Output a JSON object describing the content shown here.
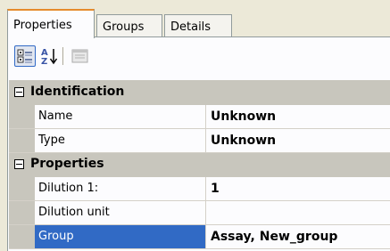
{
  "tabs": [
    {
      "label": "Properties",
      "active": true
    },
    {
      "label": "Groups",
      "active": false
    },
    {
      "label": "Details",
      "active": false
    }
  ],
  "toolbar": {
    "categorized_icon": "categorized-icon",
    "alphabetical_icon": "sort-alphabetical-icon",
    "property_pages_icon": "property-pages-icon"
  },
  "grid": {
    "categories": [
      {
        "label": "Identification",
        "expanded": true,
        "rows": [
          {
            "name": "Name",
            "value": "Unknown"
          },
          {
            "name": "Type",
            "value": "Unknown"
          }
        ]
      },
      {
        "label": "Properties",
        "expanded": true,
        "rows": [
          {
            "name": "Dilution 1:",
            "value": "1"
          },
          {
            "name": "Dilution unit",
            "value": ""
          },
          {
            "name": "Group",
            "value": "Assay, New_group",
            "selected": true
          }
        ]
      }
    ]
  },
  "colors": {
    "selection": "#316ac5",
    "category_band": "#c8c6bd",
    "tab_highlight": "#e68b2c"
  }
}
